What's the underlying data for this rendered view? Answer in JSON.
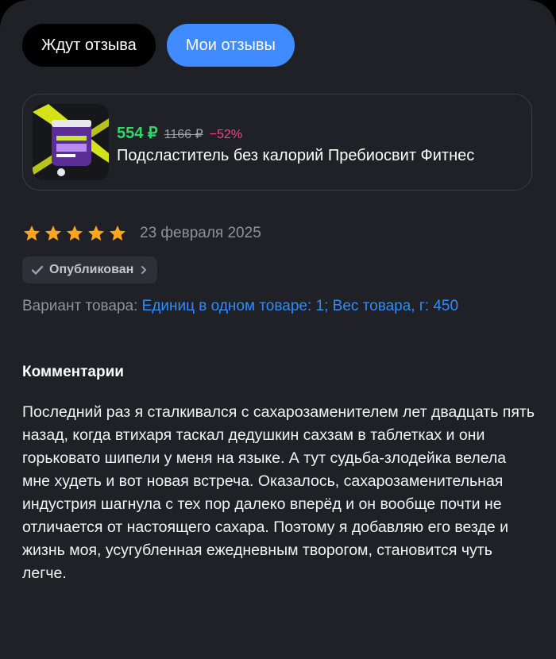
{
  "tabs": [
    {
      "label": "Ждут отзыва",
      "active": false
    },
    {
      "label": "Мои отзывы",
      "active": true
    }
  ],
  "product": {
    "price_new": "554 ₽",
    "price_old": "1166 ₽",
    "discount": "−52%",
    "title": "Подсластитель без калорий Пребиосвит Фитнес",
    "thumbnail": "product-jar-image"
  },
  "review": {
    "rating": 5,
    "rating_max": 5,
    "date": "23 февраля 2025",
    "status": "Опубликован",
    "variant_label": "Вариант товара:",
    "variant_value": "Единиц в одном товаре: 1; Вес товара, г: 450",
    "comments_heading": "Комментарии",
    "comment": "Последний раз я сталкивался с сахарозаменителем лет двадцать пять назад, когда втихаря таскал дедушкин сахзам в таблетках и они горьковато шипели у меня на языке. А тут судьба-злодейка велела мне худеть и вот новая встреча. Оказалось, сахарозаменительная индустрия шагнула с тех пор далеко вперёд и он вообще почти не отличается от настоящего сахара. Поэтому я добавляю его везде и жизнь моя, усугубленная ежедневным творогом, становится чуть легче."
  },
  "colors": {
    "background": "#1f2126",
    "accent": "#3f8bff",
    "price": "#33d46a",
    "discount": "#ff3d8b",
    "star": "#ffa51f",
    "variant_value": "#2f8cff"
  },
  "icons": {
    "star": "star-icon",
    "status_check": "check-icon",
    "status_chevron": "chevron-right-icon"
  }
}
